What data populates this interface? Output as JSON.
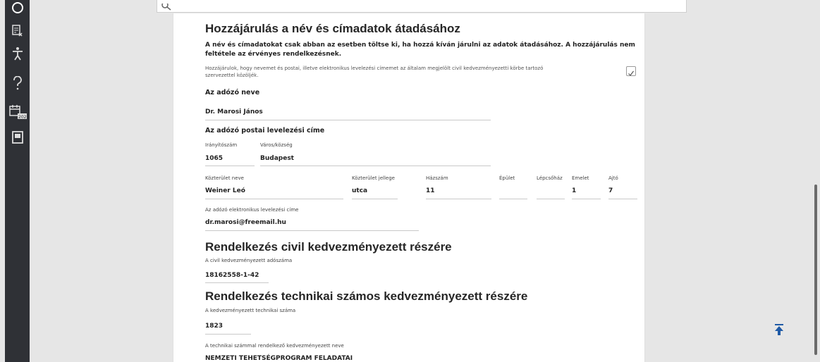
{
  "sidebar": {
    "items": [
      {
        "icon": "logo-icon"
      },
      {
        "icon": "document-edit-icon"
      },
      {
        "icon": "accessibility-icon"
      },
      {
        "icon": "help-icon"
      },
      {
        "icon": "calendar-icon",
        "badge": "2020"
      },
      {
        "icon": "saved-document-icon"
      }
    ]
  },
  "search": {
    "icon": "search-icon"
  },
  "consent": {
    "title": "Hozzájárulás a név és címadatok átadásához",
    "note_line1": "A név és címadatokat csak abban az esetben töltse ki, ha hozzá kíván járulni az adatok átadásához. A hozzájárulás nem",
    "note_line2": "feltétele az érvényes rendelkezésnek.",
    "checkbox_line1": "Hozzájárulok, hogy nevemet és postai, illetve elektronikus levelezési címemet az általam megjelölt civil kedvezményezetti körbe tartozó",
    "checkbox_line2": "szervezettel közöljék.",
    "checked": true,
    "name_heading": "Az adózó neve",
    "name_value": "Dr. Marosi János",
    "address_heading": "Az adózó postai levelezési címe",
    "zip_label": "Irányítószám",
    "zip_value": "1065",
    "city_label": "Város/község",
    "city_value": "Budapest",
    "street_label": "Közterület neve",
    "street_value": "Weiner Leó",
    "street_type_label": "Közterület jellege",
    "street_type_value": "utca",
    "house_label": "Házszám",
    "house_value": "11",
    "building_label": "Épület",
    "building_value": "",
    "stair_label": "Lépcsőház",
    "stair_value": "",
    "floor_label": "Emelet",
    "floor_value": "1",
    "door_label": "Ajtó",
    "door_value": "7",
    "email_label": "Az adózó elektronikus levelezési címe",
    "email_value": "dr.marosi@freemail.hu"
  },
  "civil": {
    "title": "Rendelkezés civil kedvezményezett részére",
    "tax_label": "A civil kedvezményezett adószáma",
    "tax_value": "18162558-1-42"
  },
  "technical": {
    "title": "Rendelkezés technikai számos kedvezményezett részére",
    "number_label": "A kedvezményezett technikai száma",
    "number_value": "1823",
    "name_label": "A technikai számmal rendelkező kedvezményezett neve",
    "name_value": "NEMZETI TEHETSÉGPROGRAM FELADATAI"
  },
  "scroll_top": {
    "icon": "scroll-to-top-icon"
  },
  "colors": {
    "sidebar": "#2f3136",
    "accent": "#1f5aa6",
    "background": "#e6e6e6"
  }
}
